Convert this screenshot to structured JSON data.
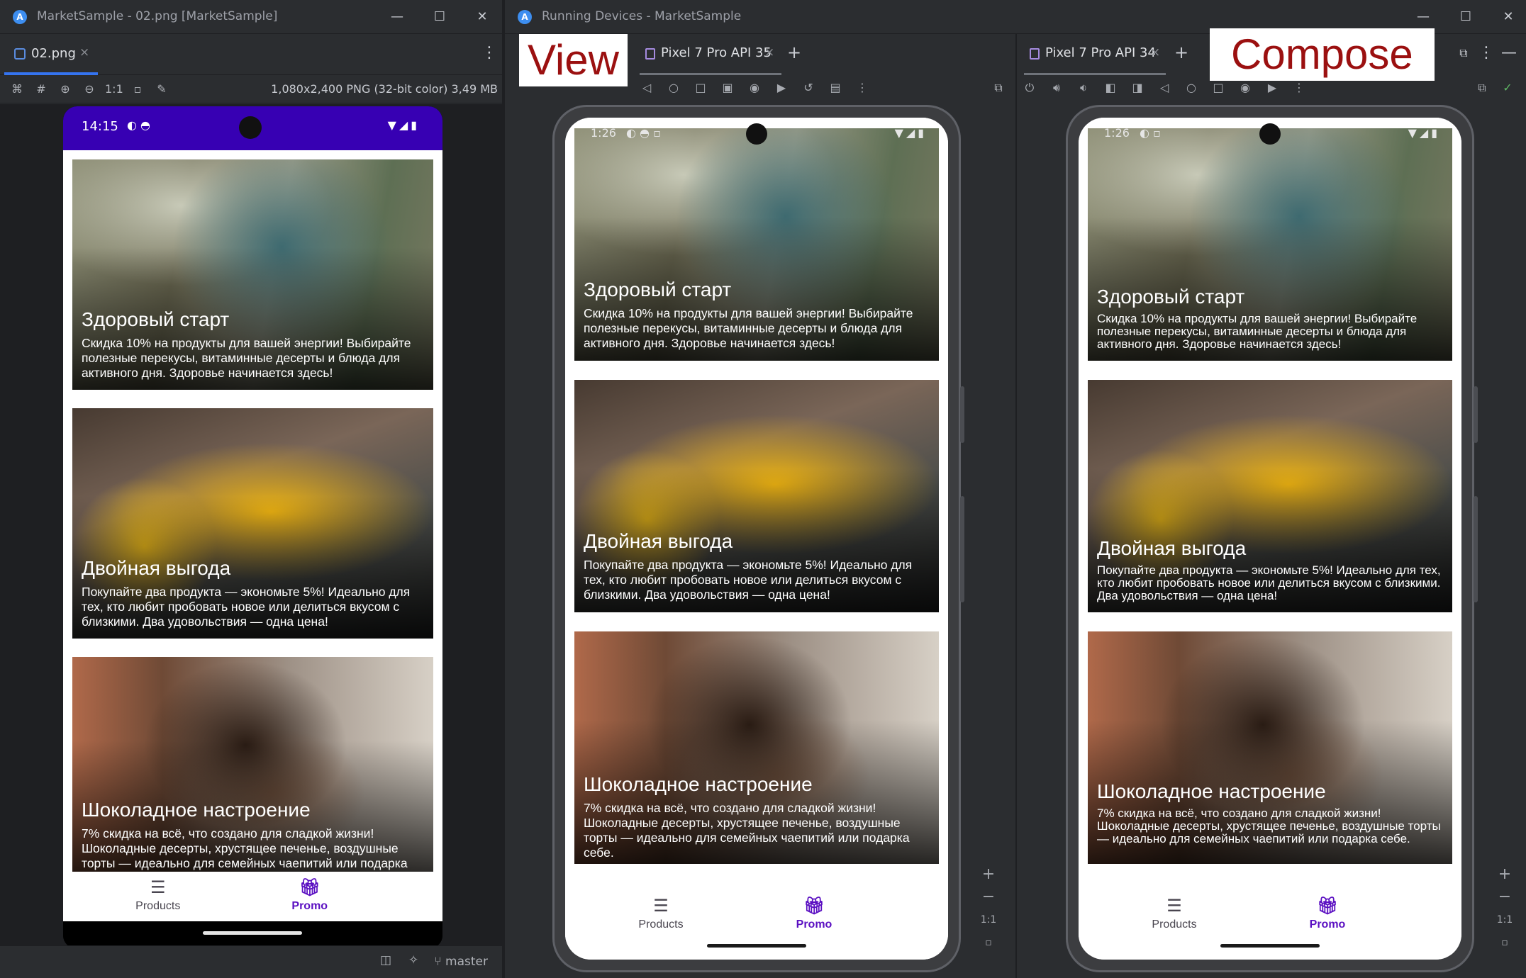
{
  "left_window": {
    "title": "MarketSample - 02.png [MarketSample]",
    "tab_name": "02.png",
    "image_info": "1,080x2,400 PNG (32-bit color) 3,49 MB",
    "zoom_label": "1:1",
    "status_time": "14:15",
    "branch": "master"
  },
  "right_window": {
    "title": "Running Devices - MarketSample",
    "left_device": "Pixel 7 Pro API 35",
    "right_device": "Pixel 7 Pro API 34",
    "status_time": "1:26",
    "zoom_label": "1:1"
  },
  "labels": {
    "view": "View",
    "compose": "Compose"
  },
  "cards": [
    {
      "title": "Здоровый старт",
      "desc": "Скидка 10% на продукты для вашей энергии! Выбирайте полезные перекусы, витаминные десерты и блюда для активного дня. Здоровье начинается здесь!"
    },
    {
      "title": "Двойная выгода",
      "desc": "Покупайте два продукта — экономьте 5%! Идеально для тех, кто любит пробовать новое или делиться вкусом с близкими. Два удовольствия — одна цена!"
    },
    {
      "title": "Шоколадное настроение",
      "desc": "7% скидка на всё, что создано для сладкой жизни! Шоколадные десерты, хрустящее печенье, воздушные торты — идеально для семейных чаепитий или подарка себе."
    }
  ],
  "nav": {
    "products": "Products",
    "promo": "Promo"
  },
  "colors": {
    "status_bar": "#3700b3",
    "accent": "#5b10c2"
  }
}
